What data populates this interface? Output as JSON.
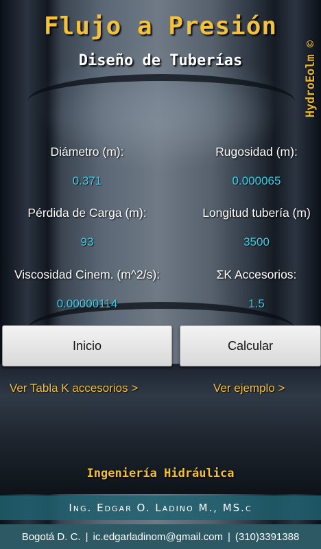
{
  "header": {
    "title": "Flujo a Presión",
    "subtitle": "Diseño de Tuberías",
    "brand": "HydroEolm ©"
  },
  "fields": {
    "diametro": {
      "label": "Diámetro (m):",
      "value": "0.371"
    },
    "rugosidad": {
      "label": "Rugosidad (m):",
      "value": "0.000065"
    },
    "perdida": {
      "label": "Pérdida de Carga (m):",
      "value": "93"
    },
    "longitud": {
      "label": "Longitud tubería (m)",
      "value": "3500"
    },
    "viscosidad": {
      "label": "Viscosidad Cinem. (m^2/s):",
      "value": "0.00000114"
    },
    "accesorios": {
      "label": "ΣK Accesorios:",
      "value": "1.5"
    }
  },
  "buttons": {
    "inicio": "Inicio",
    "calcular": "Calcular"
  },
  "links": {
    "tabla_k": "Ver Tabla K accesorios >",
    "ejemplo": "Ver ejemplo >"
  },
  "footer": {
    "title": "Ingeniería Hidráulica",
    "author": "Ing. Edgar O. Ladino M., MS.c",
    "city": "Bogotá D. C.",
    "email": "ic.edgarladinom@gmail.com",
    "phone": "(310)3391388",
    "separator": "|"
  },
  "colors": {
    "accent_yellow": "#f3c23a",
    "value_cyan": "#35d3ee",
    "author_bar": "#206070",
    "contact_bar": "#2c5964"
  }
}
